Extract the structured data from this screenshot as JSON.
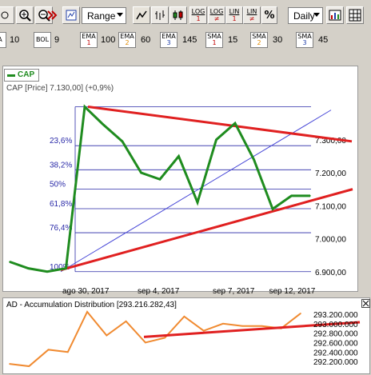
{
  "toolbar": {
    "range_label": "Range",
    "daily_label": "Daily",
    "log1_top": "LOG",
    "log1_bottom": "1",
    "log2_top": "LOG",
    "log2_bottom": "≠",
    "lin1_top": "LIN",
    "lin1_bottom": "1",
    "lin2_top": "LIN",
    "lin2_bottom": "≠",
    "percent_label": "%"
  },
  "indicators": {
    "a_top": "A",
    "a_val": "10",
    "bol_top": "BOL",
    "bol_val": "9",
    "ema1_top": "EMA",
    "ema1_n": "1",
    "ema1_val": "100",
    "ema2_top": "EMA",
    "ema2_n": "2",
    "ema2_val": "60",
    "ema3_top": "EMA",
    "ema3_n": "3",
    "ema3_val": "145",
    "sma1_top": "SMA",
    "sma1_n": "1",
    "sma1_val": "15",
    "sma2_top": "SMA",
    "sma2_n": "2",
    "sma2_val": "30",
    "sma3_top": "SMA",
    "sma3_n": "3",
    "sma3_val": "45"
  },
  "legend": {
    "series": "CAP"
  },
  "colors": {
    "price": "#1f8c1f",
    "trend": "#e02020",
    "fib": "#2a2aa8",
    "ad": "#f08a30",
    "diag": "#4a4ad8"
  },
  "chart_data": [
    {
      "type": "line",
      "title": "CAP [Price] 7.130,00] (+0,9%)",
      "series": [
        {
          "name": "CAP",
          "x": [
            1,
            2,
            3,
            4,
            5,
            6,
            7,
            8,
            9,
            10,
            11,
            12,
            13,
            14,
            15,
            16,
            17
          ],
          "values": [
            6930,
            6910,
            6900,
            6910,
            7400,
            7345,
            7295,
            7200,
            7180,
            7250,
            7110,
            7300,
            7350,
            7240,
            7090,
            7130,
            7130
          ]
        }
      ],
      "x_tick_labels": [
        "ago 30, 2017",
        "sep 4, 2017",
        "sep 7, 2017",
        "sep 12, 2017"
      ],
      "y_tick_labels": [
        "7.300,00",
        "7.200,00",
        "7.100,00",
        "7.000,00",
        "6.900,00"
      ],
      "fibonacci_labels": [
        "23,6%",
        "38,2%",
        "50%",
        "61,8%",
        "76,4%",
        "100%"
      ],
      "ylim": [
        6880,
        7440
      ],
      "grid": false
    },
    {
      "type": "line",
      "title": "AD - Accumulation Distribution [293.216.282,43]",
      "series": [
        {
          "name": "AD",
          "values": [
            292150000,
            292100000,
            292450000,
            292400000,
            293250000,
            292750000,
            293050000,
            292600000,
            292700000,
            293150000,
            292850000,
            293000000,
            292950000,
            292950000,
            292900000,
            293216282
          ]
        }
      ],
      "y_tick_labels": [
        "293.200.000",
        "293.000.000",
        "292.800.000",
        "292.600.000",
        "292.400.000",
        "292.200.000"
      ],
      "grid": false
    }
  ]
}
